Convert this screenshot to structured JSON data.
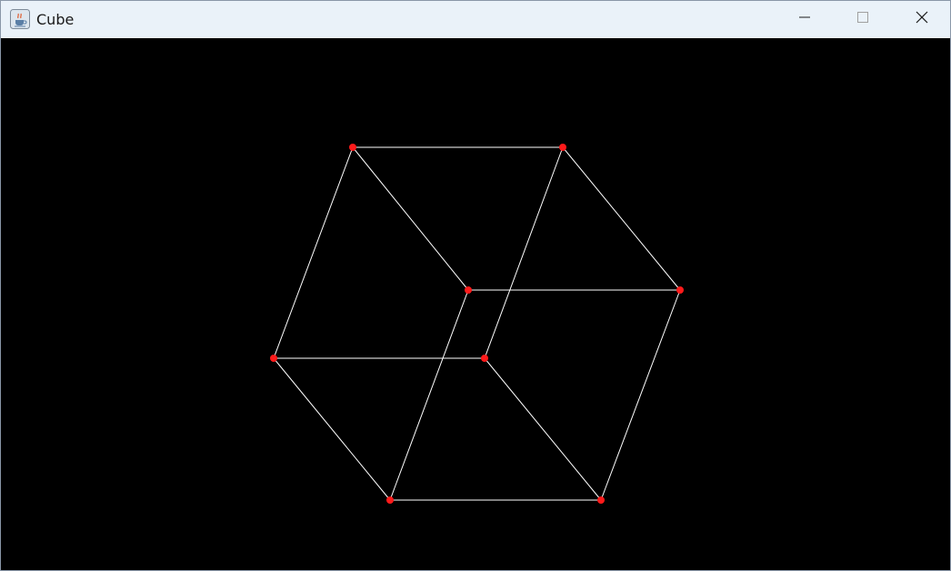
{
  "window": {
    "title": "Cube",
    "app_icon": "java-cup-icon"
  },
  "controls": {
    "minimize_icon": "minimize-icon",
    "maximize_icon": "maximize-icon",
    "close_icon": "close-icon"
  },
  "scene": {
    "background_color": "#000000",
    "edge_color": "#ffffff",
    "vertex_color": "#ff1a1a",
    "shape": "wireframe cube",
    "vertex_count": 8,
    "edge_count": 12
  }
}
